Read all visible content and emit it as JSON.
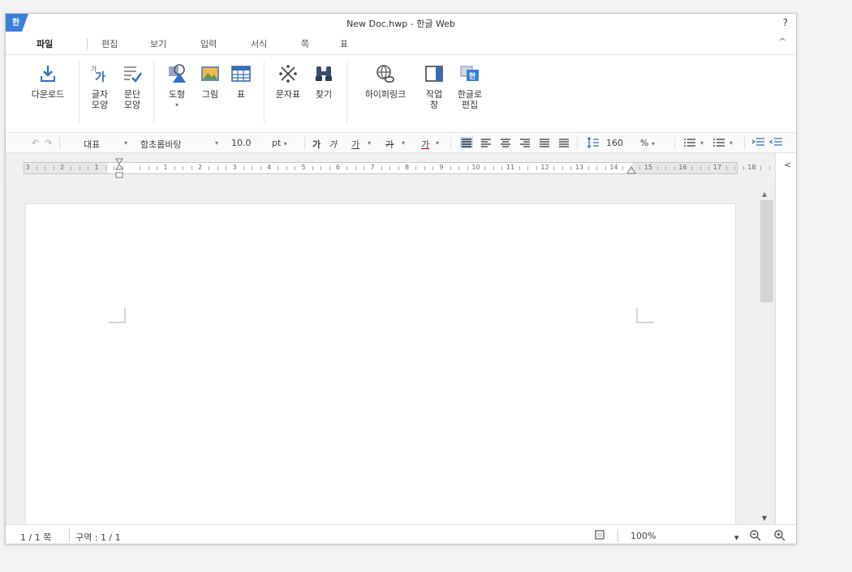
{
  "window": {
    "title": "New Doc.hwp - 한글 Web",
    "help_label": "?"
  },
  "menu": {
    "tabs": [
      "파일",
      "편집",
      "보기",
      "입력",
      "서식",
      "쪽",
      "표"
    ],
    "active_index": 0,
    "collapse_label": "^"
  },
  "ribbon": {
    "download": "다운로드",
    "char_shape": [
      "글자",
      "모양"
    ],
    "para_shape": [
      "문단",
      "모양"
    ],
    "shape": "도형",
    "picture": "그림",
    "table": "표",
    "char_map": "문자표",
    "find": "찾기",
    "hyperlink": "하이퍼링크",
    "task_pane": [
      "작업",
      "창"
    ],
    "edit_in_hangul": [
      "한글로",
      "편집"
    ]
  },
  "format_bar": {
    "style": "대표",
    "font": "함초롬바탕",
    "font_size": "10.0",
    "size_unit": "pt",
    "bold": "가",
    "italic": "가",
    "underline": "가",
    "strike": "가",
    "fontcolor": "가",
    "line_spacing": "160",
    "line_spacing_unit": "%"
  },
  "ruler": {
    "labels": [
      "3",
      "2",
      "1",
      "",
      "1",
      "2",
      "3",
      "4",
      "5",
      "6",
      "7",
      "8",
      "9",
      "10",
      "11",
      "12",
      "13",
      "14",
      "15",
      "16",
      "17",
      "18"
    ]
  },
  "status": {
    "page": "1 / 1 쪽",
    "section": "구역 : 1 / 1",
    "zoom": "100%"
  },
  "colors": {
    "accent": "#2f6fc7",
    "ribbon_icon": "#3a6db0"
  },
  "sidebar_toggle": "<"
}
